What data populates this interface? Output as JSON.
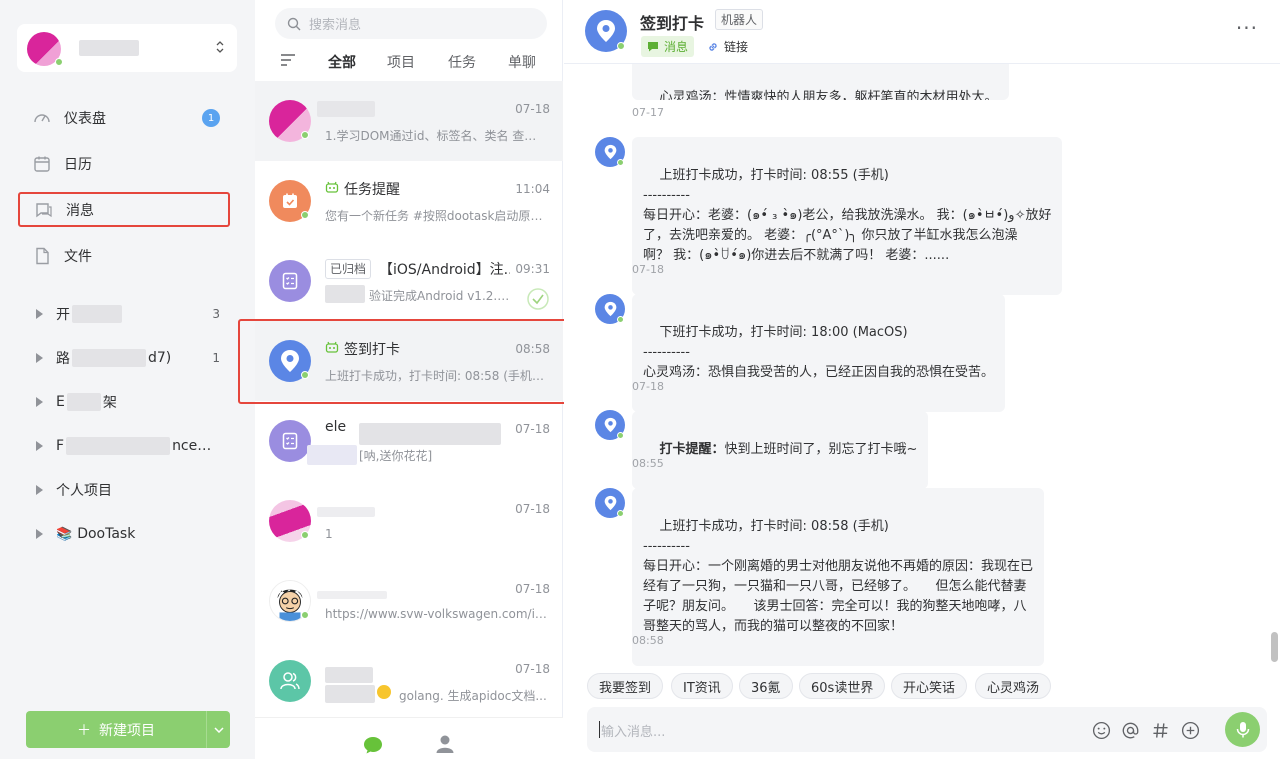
{
  "sidebar": {
    "nav": [
      {
        "label": "仪表盘",
        "badge": "1",
        "icon": "dashboard-icon"
      },
      {
        "label": "日历",
        "icon": "calendar-icon"
      },
      {
        "label": "消息",
        "icon": "message-icon"
      },
      {
        "label": "文件",
        "icon": "file-icon"
      }
    ],
    "projects": [
      {
        "name": "开",
        "count": "3"
      },
      {
        "name": "路",
        "name_tail": "d7)",
        "count": "1"
      },
      {
        "name": "E",
        "name_tail": "架"
      },
      {
        "name": "F",
        "name_tail": "nce…"
      },
      {
        "name": "个人项目"
      },
      {
        "name": "DooTask",
        "emoji": "📚"
      }
    ],
    "new_project": "新建项目"
  },
  "list": {
    "search_placeholder": "搜索消息",
    "tabs": [
      "全部",
      "项目",
      "任务",
      "单聊"
    ],
    "conversations": [
      {
        "title": "",
        "time": "07-18",
        "preview": "1.学习DOM通过id、标签名、类名 查找 ..."
      },
      {
        "title": "任务提醒",
        "time": "11:04",
        "preview": "您有一个新任务 #按照dootask启动原始...",
        "bot": true
      },
      {
        "title": "【iOS/Android】注...",
        "tag": "已归档",
        "time": "09:31",
        "preview": "验证完成Android v1.2.13..."
      },
      {
        "title": "签到打卡",
        "time": "08:58",
        "preview": "上班打卡成功，打卡时间: 08:58 (手机)-...",
        "bot": true
      },
      {
        "title": "ele",
        "time": "07-18",
        "preview": "[呐,送你花花]"
      },
      {
        "title": "",
        "time": "07-18",
        "preview": "1"
      },
      {
        "title": "",
        "time": "07-18",
        "preview": "https://www.svw-volkswagen.com/id4x/"
      },
      {
        "title": "",
        "time": "07-18",
        "preview": "golang. 生成apidoc文档..."
      }
    ]
  },
  "chat": {
    "title": "签到打卡",
    "robot_tag": "机器人",
    "tab_message": "消息",
    "tab_link": "链接",
    "messages": [
      {
        "text": "心灵鸡汤：性情爽快的人朋友多，躯杆笔直的木材用处大。",
        "time": "07-17"
      },
      {
        "text": "上班打卡成功，打卡时间: 08:55 (手机)\n----------\n每日开心：老婆：(๑•́ ₃ •̀๑)老公，给我放洗澡水。 我：(๑•̀ㅂ•́)و✧放好\n了，去洗吧亲爱的。 老婆：╭(°A°`)╮ 你只放了半缸水我怎么泡澡\n啊？ 我：(๑•̀ꇴ•́๑)你进去后不就满了吗！ 老婆：......",
        "time": "07-18"
      },
      {
        "text": "下班打卡成功，打卡时间: 18:00 (MacOS)\n----------\n心灵鸡汤：恐惧自我受苦的人，已经正因自我的恐惧在受苦。",
        "time": "07-18"
      },
      {
        "bold": "打卡提醒：",
        "text": "快到上班时间了，别忘了打卡哦~",
        "time": "08:55"
      },
      {
        "text": "上班打卡成功，打卡时间: 08:58 (手机)\n----------\n每日开心：一个刚离婚的男士对他朋友说他不再婚的原因：我现在已\n经有了一只狗，一只猫和一只八哥，已经够了。　　但怎么能代替妻\n子呢？朋友问。　　该男士回答：完全可以！我的狗整天地咆哮，八\n哥整天的骂人，而我的猫可以整夜的不回家！",
        "time": "08:58"
      }
    ],
    "quick_replies": [
      "我要签到",
      "IT资讯",
      "36氪",
      "60s读世界",
      "开心笑话",
      "心灵鸡汤"
    ],
    "input_placeholder": "输入消息..."
  }
}
